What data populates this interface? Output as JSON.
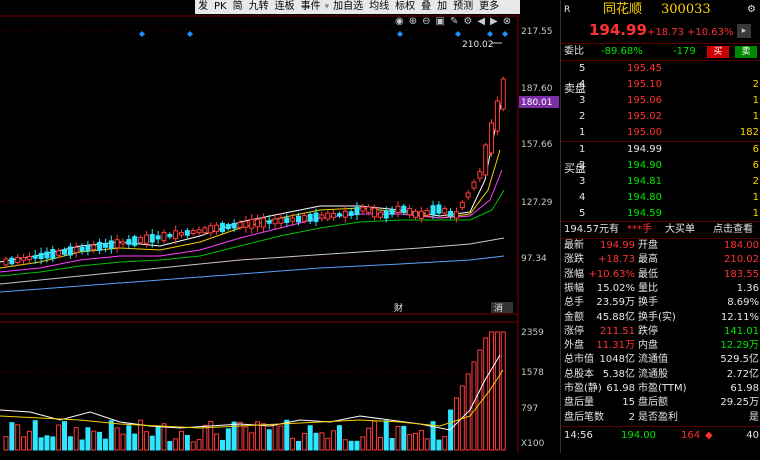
{
  "toolbar": {
    "items": [
      "发",
      "PK",
      "简",
      "九转",
      "连板",
      "事件",
      "加自选",
      "均线",
      "标权",
      "叠",
      "加",
      "预测",
      "更多"
    ]
  },
  "chart": {
    "price_ticks": [
      "217.55",
      "187.60",
      "157.66",
      "127.29",
      "97.34"
    ],
    "current_price_tag": "180.01",
    "high_marker": "210.02",
    "volume_ticks": [
      "2359",
      "1578",
      "797"
    ],
    "volume_unit": "X100",
    "markers": [
      "财",
      "消"
    ]
  },
  "panel": {
    "r_label": "R",
    "name": "同花顺",
    "code": "300033",
    "price": "194.99",
    "change": "+18.73",
    "change_pct": "+10.63%",
    "weibi_label": "委比",
    "weibi": "-89.68%",
    "weicha": "-179",
    "buy_btn": "买",
    "sell_btn": "卖",
    "sell_side_label": "卖盘",
    "buy_side_label": "买盘",
    "asks": [
      {
        "level": "5",
        "price": "195.45",
        "vol": ""
      },
      {
        "level": "4",
        "price": "195.10",
        "vol": "2"
      },
      {
        "level": "3",
        "price": "195.06",
        "vol": "1"
      },
      {
        "level": "2",
        "price": "195.02",
        "vol": "1"
      },
      {
        "level": "1",
        "price": "195.00",
        "vol": "182"
      }
    ],
    "bids": [
      {
        "level": "1",
        "price": "194.99",
        "vol": "6"
      },
      {
        "level": "2",
        "price": "194.90",
        "vol": "6"
      },
      {
        "level": "3",
        "price": "194.81",
        "vol": "2"
      },
      {
        "level": "4",
        "price": "194.80",
        "vol": "1"
      },
      {
        "level": "5",
        "price": "194.59",
        "vol": "1"
      }
    ],
    "tabs": [
      "194.57元有",
      "***手",
      "大买单",
      "点击查看"
    ],
    "stats": [
      {
        "l1": "最新",
        "v1": "194.99",
        "l2": "开盘",
        "v2": "184.00"
      },
      {
        "l1": "涨跌",
        "v1": "+18.73",
        "l2": "最高",
        "v2": "210.02"
      },
      {
        "l1": "涨幅",
        "v1": "+10.63%",
        "l2": "最低",
        "v2": "183.55"
      },
      {
        "l1": "振幅",
        "v1": "15.02%",
        "l2": "量比",
        "v2": "1.36"
      },
      {
        "l1": "总手",
        "v1": "23.59万",
        "l2": "换手",
        "v2": "8.69%"
      },
      {
        "l1": "金额",
        "v1": "45.88亿",
        "l2": "换手(实)",
        "v2": "12.11%"
      },
      {
        "l1": "涨停",
        "v1": "211.51",
        "l2": "跌停",
        "v2": "141.01"
      },
      {
        "l1": "外盘",
        "v1": "11.31万",
        "l2": "内盘",
        "v2": "12.29万"
      },
      {
        "l1": "总市值",
        "v1": "1048亿",
        "l2": "流通值",
        "v2": "529.5亿"
      },
      {
        "l1": "总股本",
        "v1": "5.38亿",
        "l2": "流通股",
        "v2": "2.72亿"
      },
      {
        "l1": "市盈(静)",
        "v1": "61.98",
        "l2": "市盈(TTM)",
        "v2": "61.98"
      },
      {
        "l1": "盘后量",
        "v1": "15",
        "l2": "盘后额",
        "v2": "29.25万"
      },
      {
        "l1": "盘后笔数",
        "v1": "2",
        "l2": "是否盈利",
        "v2": "是"
      }
    ],
    "ticks": [
      {
        "time": "14:56",
        "price": "194.00",
        "vol": "164",
        "dir": "◆",
        "extra": "40"
      }
    ],
    "colors": {
      "up": "#ff3232",
      "down": "#00e600",
      "neutral": "#e6e6e6",
      "accent": "#ffd400"
    }
  }
}
